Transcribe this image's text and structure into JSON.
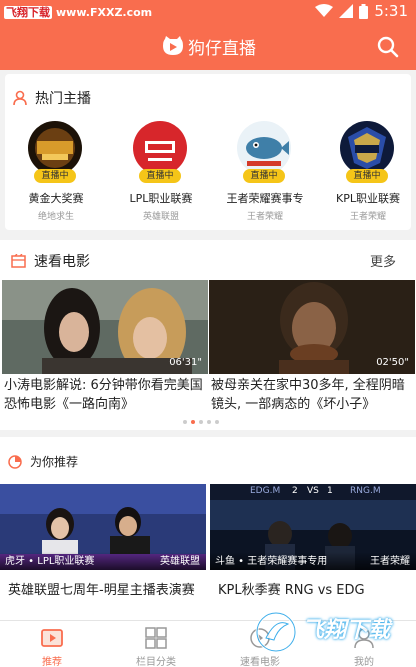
{
  "status_bar": {
    "watermark_badge": "飞翔下载",
    "watermark_url": "www.FXXZ.com",
    "time": "5:31"
  },
  "header": {
    "title": "狗仔直播",
    "logo_icon": "play-logo-icon",
    "search_icon": "search-icon"
  },
  "hot_anchors": {
    "title": "热门主播",
    "live_label": "直播中",
    "items": [
      {
        "name": "黄金大奖赛",
        "category": "绝地求生"
      },
      {
        "name": "LPL职业联赛",
        "category": "英雄联盟"
      },
      {
        "name": "王者荣耀赛事专",
        "category": "王者荣耀"
      },
      {
        "name": "KPL职业联赛",
        "category": "王者荣耀"
      }
    ]
  },
  "movies": {
    "title": "速看电影",
    "more": "更多",
    "items": [
      {
        "duration": "06'31\"",
        "caption": "小涛电影解说: 6分钟带你看完美国恐怖电影《一路向南》"
      },
      {
        "duration": "02'50\"",
        "caption": "被母亲关在家中30多年, 全程阴暗镜头, 一部病态的《坏小子》"
      }
    ],
    "page_index": 1,
    "page_count": 5
  },
  "recommend": {
    "title": "为你推荐",
    "items": [
      {
        "source": "虎牙 • LPL职业联赛",
        "tag": "英雄联盟",
        "title": "英雄联盟七周年-明星主播表演赛"
      },
      {
        "source": "斗鱼 • 王者荣耀赛事专用",
        "tag": "王者荣耀",
        "title": "KPL秋季赛  RNG vs EDG"
      }
    ]
  },
  "scoreboard": {
    "left_score": "2",
    "vs": "VS",
    "right_score": "1",
    "left_team": "EDG.M",
    "right_team": "RNG.M"
  },
  "bottom_nav": {
    "items": [
      {
        "label": "推荐",
        "active": true
      },
      {
        "label": "栏目分类",
        "active": false
      },
      {
        "label": "速看电影",
        "active": false
      },
      {
        "label": "我的",
        "active": false
      }
    ]
  },
  "bottom_watermark": "飞翔下载",
  "colors": {
    "accent": "#f96d4e",
    "badge": "#f5c518"
  }
}
